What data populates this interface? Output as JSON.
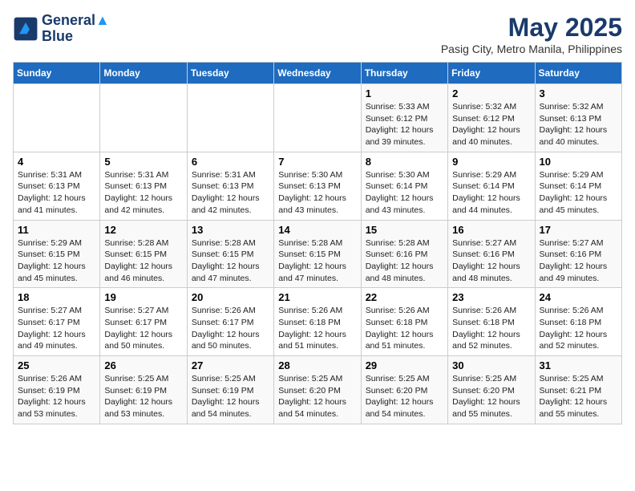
{
  "logo": {
    "line1": "General",
    "line2": "Blue"
  },
  "title": "May 2025",
  "subtitle": "Pasig City, Metro Manila, Philippines",
  "weekdays": [
    "Sunday",
    "Monday",
    "Tuesday",
    "Wednesday",
    "Thursday",
    "Friday",
    "Saturday"
  ],
  "weeks": [
    [
      {
        "day": "",
        "info": ""
      },
      {
        "day": "",
        "info": ""
      },
      {
        "day": "",
        "info": ""
      },
      {
        "day": "",
        "info": ""
      },
      {
        "day": "1",
        "info": "Sunrise: 5:33 AM\nSunset: 6:12 PM\nDaylight: 12 hours\nand 39 minutes."
      },
      {
        "day": "2",
        "info": "Sunrise: 5:32 AM\nSunset: 6:12 PM\nDaylight: 12 hours\nand 40 minutes."
      },
      {
        "day": "3",
        "info": "Sunrise: 5:32 AM\nSunset: 6:13 PM\nDaylight: 12 hours\nand 40 minutes."
      }
    ],
    [
      {
        "day": "4",
        "info": "Sunrise: 5:31 AM\nSunset: 6:13 PM\nDaylight: 12 hours\nand 41 minutes."
      },
      {
        "day": "5",
        "info": "Sunrise: 5:31 AM\nSunset: 6:13 PM\nDaylight: 12 hours\nand 42 minutes."
      },
      {
        "day": "6",
        "info": "Sunrise: 5:31 AM\nSunset: 6:13 PM\nDaylight: 12 hours\nand 42 minutes."
      },
      {
        "day": "7",
        "info": "Sunrise: 5:30 AM\nSunset: 6:13 PM\nDaylight: 12 hours\nand 43 minutes."
      },
      {
        "day": "8",
        "info": "Sunrise: 5:30 AM\nSunset: 6:14 PM\nDaylight: 12 hours\nand 43 minutes."
      },
      {
        "day": "9",
        "info": "Sunrise: 5:29 AM\nSunset: 6:14 PM\nDaylight: 12 hours\nand 44 minutes."
      },
      {
        "day": "10",
        "info": "Sunrise: 5:29 AM\nSunset: 6:14 PM\nDaylight: 12 hours\nand 45 minutes."
      }
    ],
    [
      {
        "day": "11",
        "info": "Sunrise: 5:29 AM\nSunset: 6:15 PM\nDaylight: 12 hours\nand 45 minutes."
      },
      {
        "day": "12",
        "info": "Sunrise: 5:28 AM\nSunset: 6:15 PM\nDaylight: 12 hours\nand 46 minutes."
      },
      {
        "day": "13",
        "info": "Sunrise: 5:28 AM\nSunset: 6:15 PM\nDaylight: 12 hours\nand 47 minutes."
      },
      {
        "day": "14",
        "info": "Sunrise: 5:28 AM\nSunset: 6:15 PM\nDaylight: 12 hours\nand 47 minutes."
      },
      {
        "day": "15",
        "info": "Sunrise: 5:28 AM\nSunset: 6:16 PM\nDaylight: 12 hours\nand 48 minutes."
      },
      {
        "day": "16",
        "info": "Sunrise: 5:27 AM\nSunset: 6:16 PM\nDaylight: 12 hours\nand 48 minutes."
      },
      {
        "day": "17",
        "info": "Sunrise: 5:27 AM\nSunset: 6:16 PM\nDaylight: 12 hours\nand 49 minutes."
      }
    ],
    [
      {
        "day": "18",
        "info": "Sunrise: 5:27 AM\nSunset: 6:17 PM\nDaylight: 12 hours\nand 49 minutes."
      },
      {
        "day": "19",
        "info": "Sunrise: 5:27 AM\nSunset: 6:17 PM\nDaylight: 12 hours\nand 50 minutes."
      },
      {
        "day": "20",
        "info": "Sunrise: 5:26 AM\nSunset: 6:17 PM\nDaylight: 12 hours\nand 50 minutes."
      },
      {
        "day": "21",
        "info": "Sunrise: 5:26 AM\nSunset: 6:18 PM\nDaylight: 12 hours\nand 51 minutes."
      },
      {
        "day": "22",
        "info": "Sunrise: 5:26 AM\nSunset: 6:18 PM\nDaylight: 12 hours\nand 51 minutes."
      },
      {
        "day": "23",
        "info": "Sunrise: 5:26 AM\nSunset: 6:18 PM\nDaylight: 12 hours\nand 52 minutes."
      },
      {
        "day": "24",
        "info": "Sunrise: 5:26 AM\nSunset: 6:18 PM\nDaylight: 12 hours\nand 52 minutes."
      }
    ],
    [
      {
        "day": "25",
        "info": "Sunrise: 5:26 AM\nSunset: 6:19 PM\nDaylight: 12 hours\nand 53 minutes."
      },
      {
        "day": "26",
        "info": "Sunrise: 5:25 AM\nSunset: 6:19 PM\nDaylight: 12 hours\nand 53 minutes."
      },
      {
        "day": "27",
        "info": "Sunrise: 5:25 AM\nSunset: 6:19 PM\nDaylight: 12 hours\nand 54 minutes."
      },
      {
        "day": "28",
        "info": "Sunrise: 5:25 AM\nSunset: 6:20 PM\nDaylight: 12 hours\nand 54 minutes."
      },
      {
        "day": "29",
        "info": "Sunrise: 5:25 AM\nSunset: 6:20 PM\nDaylight: 12 hours\nand 54 minutes."
      },
      {
        "day": "30",
        "info": "Sunrise: 5:25 AM\nSunset: 6:20 PM\nDaylight: 12 hours\nand 55 minutes."
      },
      {
        "day": "31",
        "info": "Sunrise: 5:25 AM\nSunset: 6:21 PM\nDaylight: 12 hours\nand 55 minutes."
      }
    ]
  ]
}
